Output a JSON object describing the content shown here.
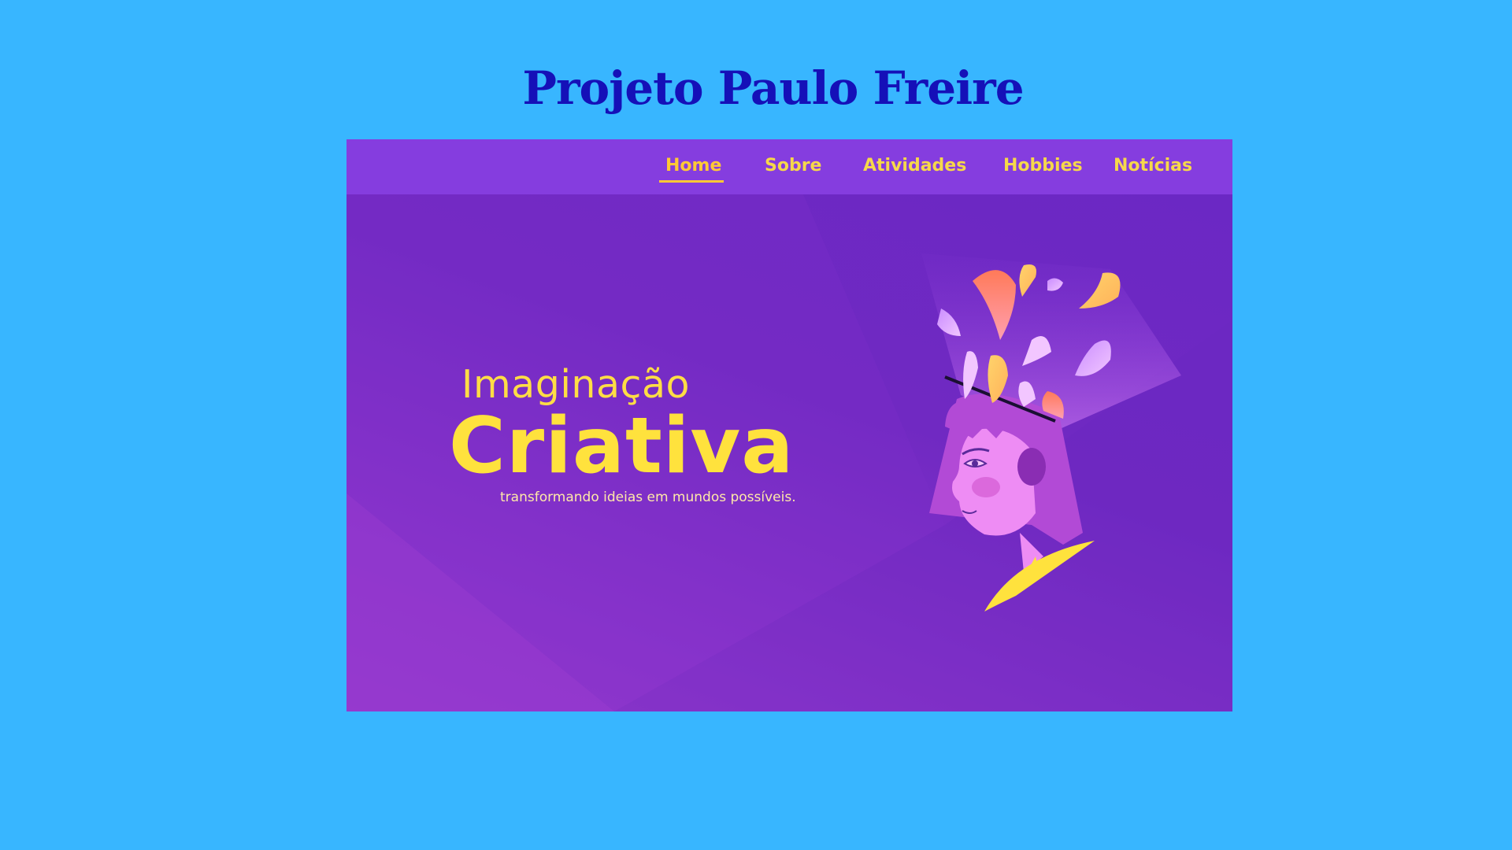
{
  "page": {
    "title": "Projeto Paulo Freire"
  },
  "nav": {
    "items": [
      {
        "label": "Home",
        "active": true
      },
      {
        "label": "Sobre",
        "active": false
      },
      {
        "label": "Atividades",
        "active": false
      },
      {
        "label": "Hobbies",
        "active": false
      },
      {
        "label": "Notícias",
        "active": false
      }
    ]
  },
  "hero": {
    "title_small": "Imaginação",
    "title_big": "Criativa",
    "tagline": "transformando ideias em mundos possíveis."
  },
  "colors": {
    "page_background": "#38b6ff",
    "title": "#1510b8",
    "navbar": "#853ddf",
    "hero_background": "#7029c2",
    "accent_yellow": "#ffe23d"
  },
  "icons": {
    "illustration": "creative-head-illustration"
  }
}
